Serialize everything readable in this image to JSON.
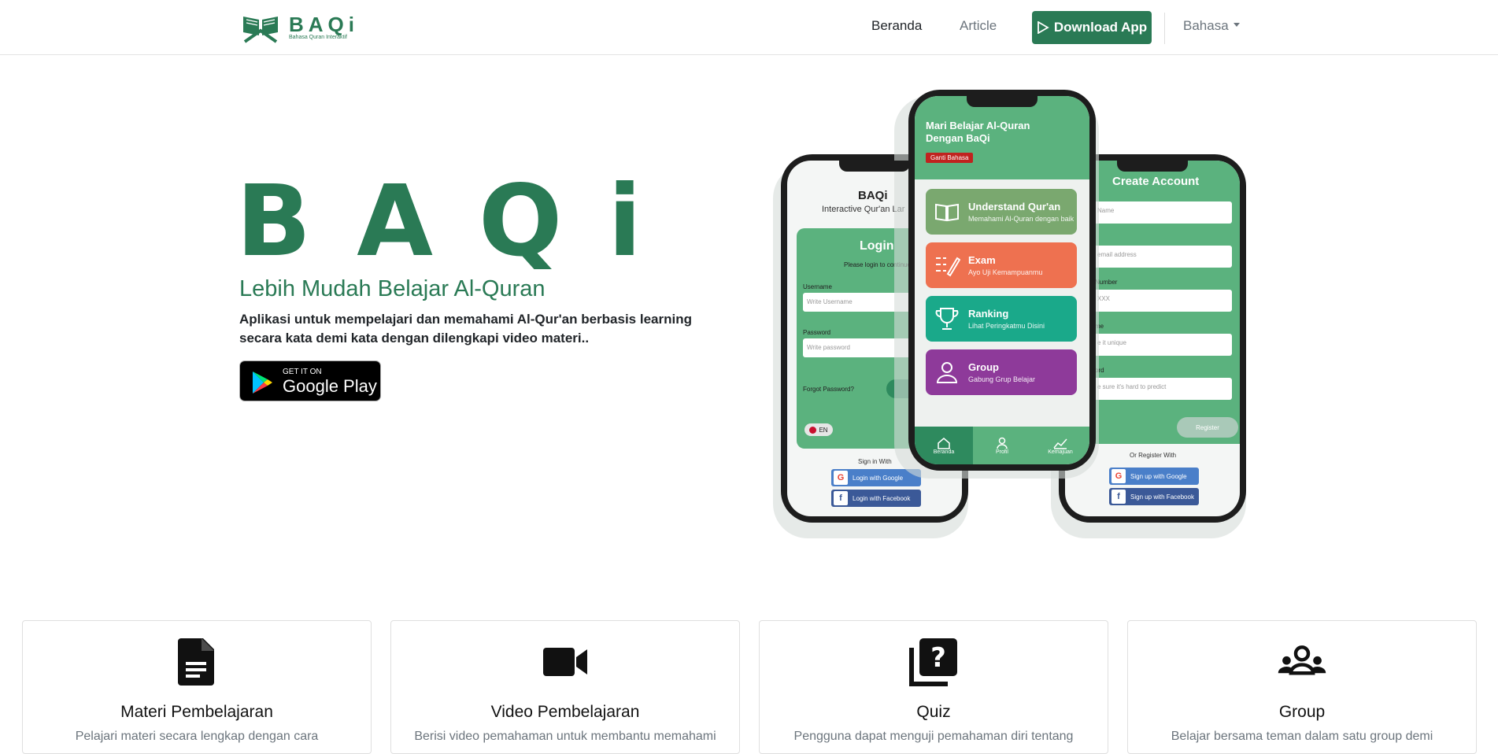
{
  "nav": {
    "brand_name": "BAQi",
    "brand_tagline": "Bahasa Quran Interaktif",
    "home": "Beranda",
    "article": "Article",
    "download": "Download App",
    "language": "Bahasa"
  },
  "hero": {
    "title": "BAQi",
    "subtitle": "Lebih Mudah Belajar Al-Quran",
    "description": "Aplikasi untuk mempelajari dan memahami Al-Qur'an berbasis learning secara kata demi kata dengan dilengkapi video materi..",
    "store_small": "GET IT ON",
    "store_big": "Google Play"
  },
  "phone_left": {
    "app_name": "BAQi",
    "app_tagline": "Interactive Qur'an Lar",
    "login_title": "Login",
    "login_hint": "Please login to continue",
    "username_label": "Username",
    "username_placeholder": "Write Username",
    "password_label": "Password",
    "password_placeholder": "Write password",
    "forgot": "Forgot Password?",
    "lang": "EN",
    "sign_in_with": "Sign in With",
    "google": "Login with Google",
    "facebook": "Login with Facebook"
  },
  "phone_center": {
    "header": "Mari Belajar Al-Quran Dengan BaQi",
    "change_lang": "Ganti Bahasa",
    "menu": [
      {
        "title": "Understand Qur'an",
        "sub": "Memahami Al-Quran dengan baik",
        "color": "#7aa86f"
      },
      {
        "title": "Exam",
        "sub": "Ayo Uji Kemampuanmu",
        "color": "#ee7150"
      },
      {
        "title": "Ranking",
        "sub": "Lihat Peringkatmu Disini",
        "color": "#1aa98a"
      },
      {
        "title": "Group",
        "sub": "Gabung Grup Belajar",
        "color": "#8e3a9a"
      }
    ],
    "tabs": [
      "Beranda",
      "Profil",
      "Kemajuan"
    ]
  },
  "phone_right": {
    "title": "Create Account",
    "name_ph": "Name",
    "email_ph": "email address",
    "phone_label": "Number",
    "phone_ph": "XXX",
    "username_label": "me",
    "username_ph": "e it unique",
    "password_label": "ord",
    "password_ph": "e sure it's hard to predict",
    "register": "Register",
    "or_register": "Or Register With",
    "google": "Sign up with Google",
    "facebook": "Sign up with Facebook"
  },
  "features": [
    {
      "title": "Materi Pembelajaran",
      "desc": "Pelajari materi secara lengkap dengan cara",
      "icon": "document-icon"
    },
    {
      "title": "Video Pembelajaran",
      "desc": "Berisi video pemahaman untuk membantu memahami",
      "icon": "video-camera-icon"
    },
    {
      "title": "Quiz",
      "desc": "Pengguna dapat menguji pemahaman diri tentang",
      "icon": "quiz-icon"
    },
    {
      "title": "Group",
      "desc": "Belajar bersama teman dalam satu group demi",
      "icon": "group-icon"
    }
  ],
  "colors": {
    "brand": "#2a7a55",
    "accent": "#5bb27e"
  }
}
